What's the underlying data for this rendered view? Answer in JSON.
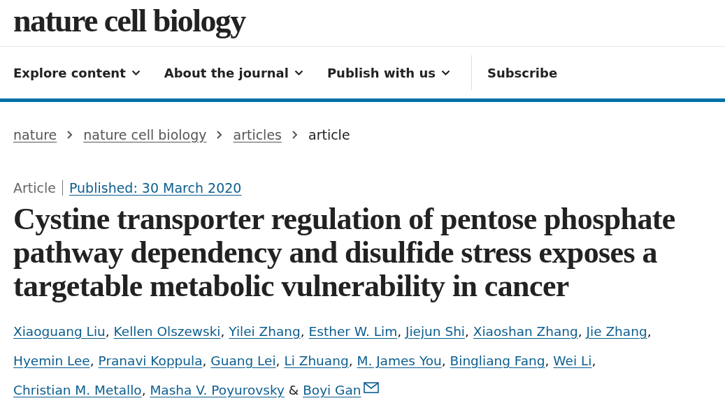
{
  "logo": "nature cell biology",
  "nav": [
    {
      "label": "Explore content",
      "dropdown": true
    },
    {
      "label": "About the journal",
      "dropdown": true
    },
    {
      "label": "Publish with us",
      "dropdown": true
    },
    {
      "label": "Subscribe",
      "dropdown": false
    }
  ],
  "breadcrumb": [
    {
      "label": "nature",
      "link": true
    },
    {
      "label": "nature cell biology",
      "link": true
    },
    {
      "label": "articles",
      "link": true
    },
    {
      "label": "article",
      "link": false
    }
  ],
  "article_type": "Article",
  "published": "Published: 30 March 2020",
  "title": "Cystine transporter regulation of pentose phosphate pathway dependency and disulfide stress exposes a targetable metabolic vulnerability in cancer",
  "authors": [
    {
      "name": "Xiaoguang Liu",
      "after": ","
    },
    {
      "name": "Kellen Olszewski",
      "after": ","
    },
    {
      "name": "Yilei Zhang",
      "after": ","
    },
    {
      "name": "Esther W. Lim",
      "after": ","
    },
    {
      "name": "Jiejun Shi",
      "after": ","
    },
    {
      "name": "Xiaoshan Zhang",
      "after": ","
    },
    {
      "name": "Jie Zhang",
      "after": ","
    },
    {
      "name": "Hyemin Lee",
      "after": ","
    },
    {
      "name": "Pranavi Koppula",
      "after": ","
    },
    {
      "name": "Guang Lei",
      "after": ","
    },
    {
      "name": "Li Zhuang",
      "after": ","
    },
    {
      "name": "M. James You",
      "after": ","
    },
    {
      "name": "Bingliang Fang",
      "after": ","
    },
    {
      "name": "Wei Li",
      "after": ","
    },
    {
      "name": "Christian M. Metallo",
      "after": ","
    },
    {
      "name": "Masha V. Poyurovsky",
      "after": " &"
    },
    {
      "name": "Boyi Gan",
      "email": true
    }
  ]
}
